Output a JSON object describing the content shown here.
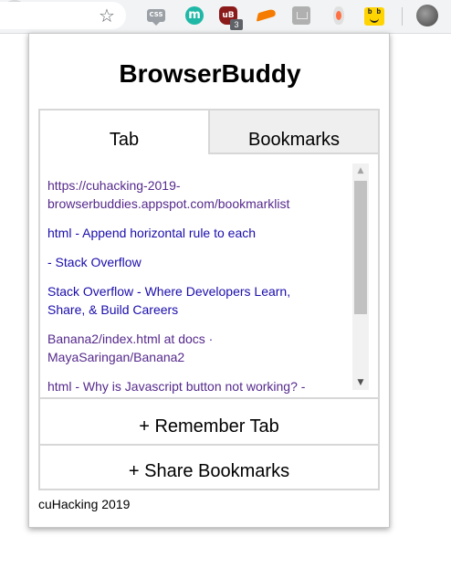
{
  "browser": {
    "toolbar_icons": [
      "star-icon",
      "css-extension-icon",
      "m-extension-icon",
      "ublock-icon",
      "bird-extension-icon",
      "grey-extension-icon",
      "egg-extension-icon",
      "browserbuddy-extension-icon",
      "profile-avatar"
    ],
    "ublock_badge": "3",
    "css_label": "CSS",
    "m_label": "m",
    "ub_label": "uB",
    "bb_label": "b b"
  },
  "popup": {
    "title": "BrowserBuddy",
    "tabs": [
      {
        "label": "Tab"
      },
      {
        "label": "Bookmarks"
      }
    ],
    "links": [
      {
        "text": "https://cuhacking-2019-browserbuddies.appspot.com/bookmarklist",
        "state": "visited"
      },
      {
        "text": "html - Append horizontal rule to each",
        "state": "unvisited"
      },
      {
        "text": "- Stack Overflow",
        "state": "unvisited"
      },
      {
        "text": "Stack Overflow - Where Developers Learn, Share, & Build Careers",
        "state": "unvisited"
      },
      {
        "text": "Banana2/index.html at docs · MayaSaringan/Banana2",
        "state": "visited"
      },
      {
        "text": "html - Why is Javascript button not working? -",
        "state": "visited"
      }
    ],
    "scrollbar": {
      "up": "▲",
      "down": "▼"
    },
    "actions": {
      "remember": "+ Remember Tab",
      "share": "+ Share Bookmarks"
    },
    "footer": "cuHacking 2019"
  },
  "colors": {
    "visited_link": "#55298c",
    "unvisited_link": "#1a0dab",
    "border": "#d7d7d7",
    "inactive_tab": "#efefef"
  }
}
